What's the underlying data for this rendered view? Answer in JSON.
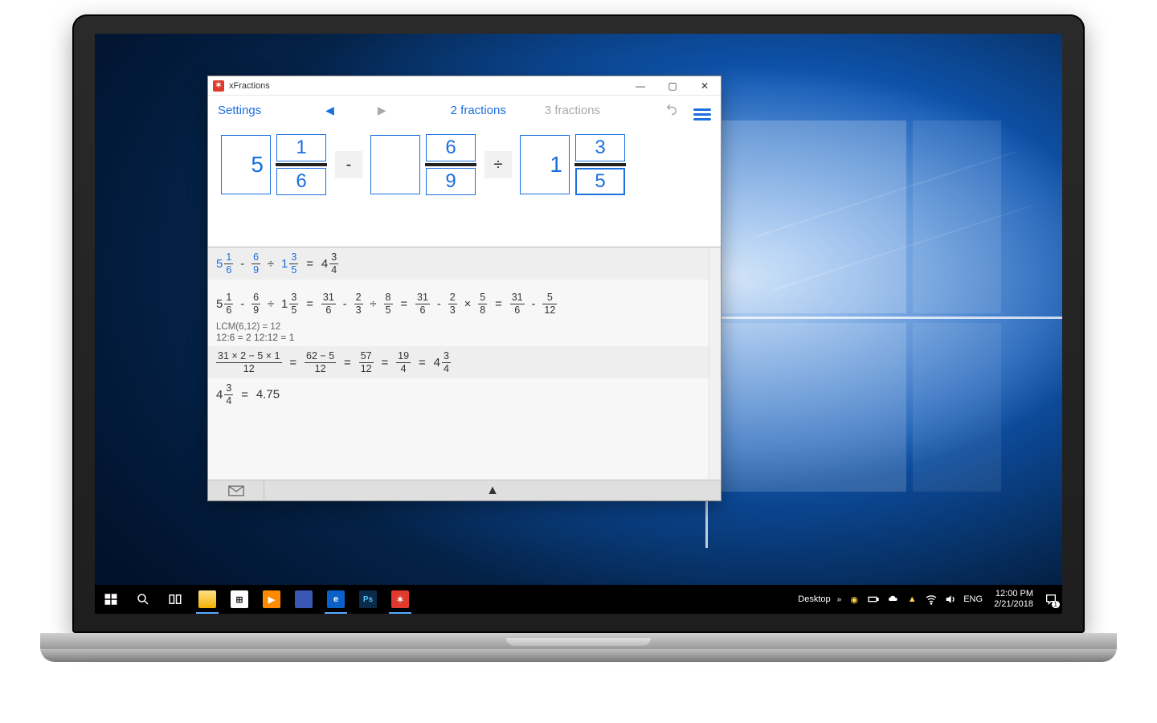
{
  "app": {
    "title": "xFractions",
    "toolbar": {
      "settings": "Settings",
      "two_fractions": "2 fractions",
      "three_fractions": "3 fractions"
    },
    "inputs": {
      "f1": {
        "whole": "5",
        "num": "1",
        "den": "6"
      },
      "op1": "-",
      "f2": {
        "whole": "",
        "num": "6",
        "den": "9"
      },
      "op2": "÷",
      "f3": {
        "whole": "1",
        "num": "3",
        "den": "5"
      }
    },
    "solution": {
      "row1_lhs": {
        "w": "5",
        "n": "1",
        "d": "6"
      },
      "row1_m": {
        "n": "6",
        "d": "9"
      },
      "row1_div": {
        "w": "1",
        "n": "3",
        "d": "5"
      },
      "row1_res": {
        "w": "4",
        "n": "3",
        "d": "4"
      },
      "row2": {
        "a": {
          "w": "5",
          "n": "1",
          "d": "6"
        },
        "b": {
          "n": "6",
          "d": "9"
        },
        "c": {
          "w": "1",
          "n": "3",
          "d": "5"
        },
        "d": {
          "n": "31",
          "d": "6"
        },
        "e": {
          "n": "2",
          "d": "3"
        },
        "f": {
          "n": "8",
          "d": "5"
        },
        "g": {
          "n": "31",
          "d": "6"
        },
        "h": {
          "n": "2",
          "d": "3"
        },
        "i": {
          "n": "5",
          "d": "8"
        },
        "j": {
          "n": "31",
          "d": "6"
        },
        "k": {
          "n": "5",
          "d": "12"
        }
      },
      "lcm_label": "LCM(6,12) = 12",
      "lcm_detail": "12:6 = 2    12:12 = 1",
      "row3": {
        "a": {
          "n": "31 × 2 − 5 × 1",
          "d": "12"
        },
        "b": {
          "n": "62 − 5",
          "d": "12"
        },
        "c": {
          "n": "57",
          "d": "12"
        },
        "d": {
          "n": "19",
          "d": "4"
        },
        "e": {
          "w": "4",
          "n": "3",
          "d": "4"
        }
      },
      "row4": {
        "mixed": {
          "w": "4",
          "n": "3",
          "d": "4"
        },
        "dec": "4.75"
      }
    }
  },
  "taskbar": {
    "desktop_label": "Desktop",
    "lang": "ENG",
    "time": "12:00 PM",
    "date": "2/21/2018",
    "notif_count": "1"
  }
}
